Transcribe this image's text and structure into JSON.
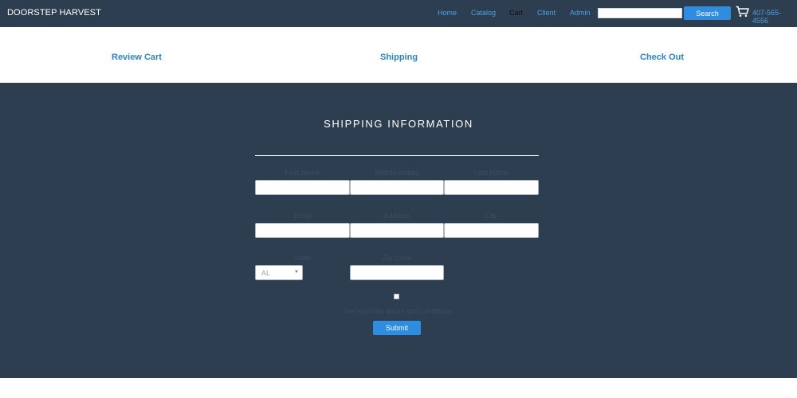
{
  "brand": "DOORSTEP HARVEST",
  "nav": {
    "home": "Home",
    "catalog": "Catalog",
    "cart": "Cart",
    "client": "Client",
    "admin": "Admin"
  },
  "search": {
    "value": "",
    "button": "Search"
  },
  "phone": "407-565-4556",
  "steps": {
    "review": "Review Cart",
    "shipping": "Shipping",
    "checkout": "Check Out"
  },
  "form": {
    "title": "SHIPPING INFORMATION",
    "first_name": "First Name",
    "middle_initials": "Middle Initials",
    "last_name": "Last Name",
    "email": "Email",
    "address": "Address",
    "city": "City",
    "state": "State",
    "state_value": "AL",
    "zip": "Zip Code",
    "terms": "I've read the terms and conditions",
    "submit": "Submit"
  },
  "colors": {
    "navbar": "#2c3e50",
    "panel": "#2c3e50",
    "link": "#4aa3e8",
    "accent": "#2e8de0",
    "step": "#2c84c9"
  }
}
